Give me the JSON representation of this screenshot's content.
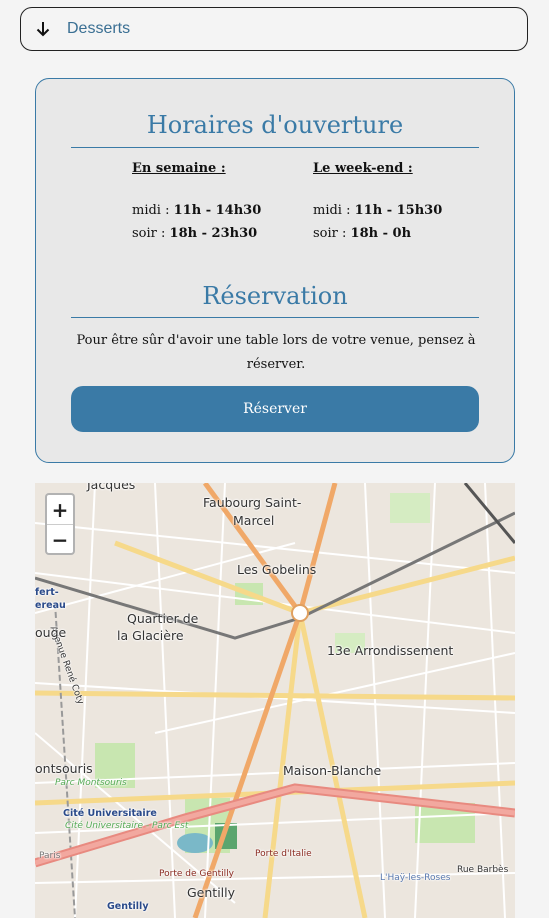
{
  "accordion": {
    "label": "Desserts",
    "icon": "arrow-down-icon"
  },
  "hours": {
    "title": "Horaires d'ouverture",
    "weekday": {
      "heading": "En semaine :",
      "midi_label": "midi :",
      "midi_time": "11h - 14h30",
      "soir_label": "soir :",
      "soir_time": "18h - 23h30"
    },
    "weekend": {
      "heading": "Le week-end :",
      "midi_label": "midi :",
      "midi_time": "11h - 15h30",
      "soir_label": "soir :",
      "soir_time": "18h - 0h"
    }
  },
  "reservation": {
    "title": "Réservation",
    "text": "Pour être sûr d'avoir une table lors de votre venue, pensez à réserver.",
    "button": "Réserver"
  },
  "map": {
    "zoom_in": "+",
    "zoom_out": "−",
    "labels": {
      "jacques": "Jacques",
      "faubourg": "Faubourg Saint-",
      "marcel": "Marcel",
      "gobelins": "Les Gobelins",
      "quartier": "Quartier de",
      "glaciere": "la Glacière",
      "arrondissement": "13e Arrondissement",
      "maison_blanche": "Maison-Blanche",
      "montsouris": "ontsouris",
      "parc_montsouris": "Parc Montsouris",
      "cite_univ": "Cité Universitaire",
      "cite_univ_parc": "Cité Universitaire - Parc Est",
      "porte_italie": "Porte d'Italie",
      "porte_gentilly": "Porte de Gentilly",
      "gentilly": "Gentilly",
      "gentilly_station": "Gentilly",
      "hay_roses": "L'Haÿ-les-Roses",
      "rue_barbes": "Rue Barbès",
      "avenue_rene_coty": "Avenue René Coty",
      "ouge": "ouge",
      "fert": "fert-",
      "ereau": "ereau",
      "paris": "Paris"
    }
  }
}
